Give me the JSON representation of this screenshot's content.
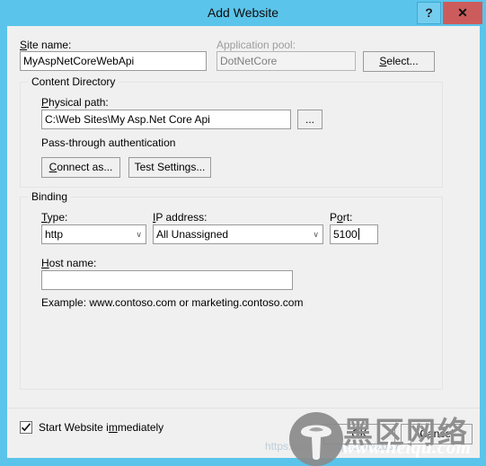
{
  "window": {
    "title": "Add Website",
    "help_label": "?",
    "close_label": "✕"
  },
  "site": {
    "name_label": "Site name:",
    "name_value": "MyAspNetCoreWebApi",
    "app_pool_label": "Application pool:",
    "app_pool_value": "DotNetCore",
    "select_button": "Select..."
  },
  "content_directory": {
    "group_title": "Content Directory",
    "physical_path_label": "Physical path:",
    "physical_path_value": "C:\\Web Sites\\My Asp.Net Core Api",
    "browse_button": "...",
    "auth_text": "Pass-through authentication",
    "connect_as_button": "Connect as...",
    "test_settings_button": "Test Settings..."
  },
  "binding": {
    "group_title": "Binding",
    "type_label": "Type:",
    "type_value": "http",
    "ip_label": "IP address:",
    "ip_value": "All Unassigned",
    "port_label": "Port:",
    "port_value": "5100",
    "host_label": "Host name:",
    "host_value": "",
    "example_text": "Example: www.contoso.com or marketing.contoso.com",
    "dropdown_arrow": "∨"
  },
  "footer": {
    "start_website_label": "Start Website immediately",
    "start_website_checked": true,
    "ok_button": "OK",
    "cancel_button": "Cancel"
  },
  "watermark": {
    "cn_text": "黑区网络",
    "url_text": "www.heiqu.com",
    "faint_url_text": "https://www.heiqu.com/2097"
  },
  "colors": {
    "title_bar": "#5bc4ea",
    "close_button": "#cc5c5c",
    "dialog_body": "#f0f0f0",
    "field_border": "#9a9a9a"
  }
}
